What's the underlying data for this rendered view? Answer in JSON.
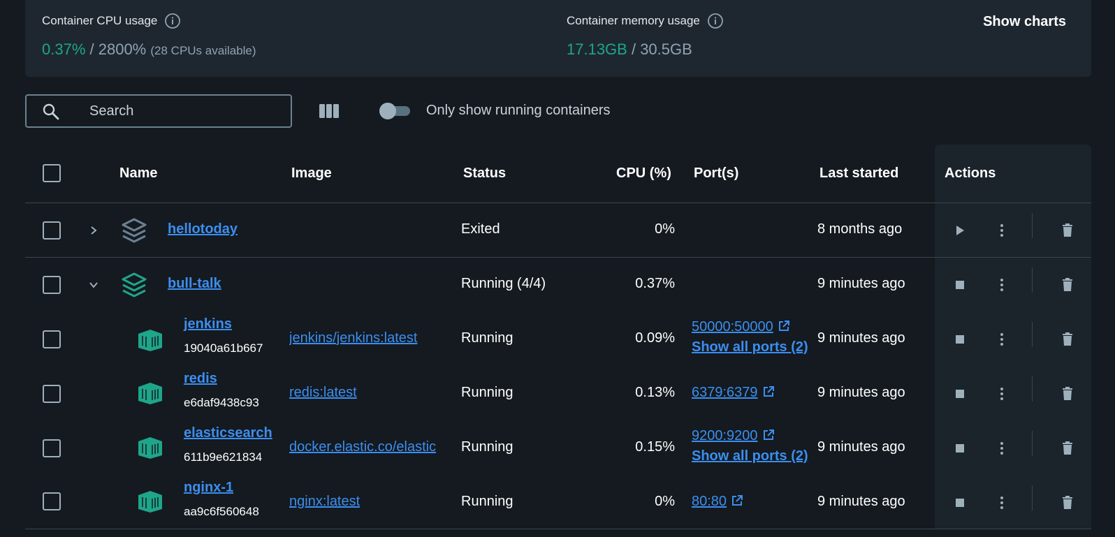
{
  "stats": {
    "cpu_title": "Container CPU usage",
    "cpu_used": "0.37%",
    "cpu_sep": " / ",
    "cpu_total": "2800%",
    "cpu_note": "(28 CPUs available)",
    "mem_title": "Container memory usage",
    "mem_used": "17.13GB",
    "mem_sep": " / ",
    "mem_total": "30.5GB",
    "show_charts": "Show charts"
  },
  "toolbar": {
    "search_placeholder": "Search",
    "toggle_label": "Only show running containers",
    "toggle_on": false
  },
  "table": {
    "headers": {
      "name": "Name",
      "image": "Image",
      "status": "Status",
      "cpu": "CPU (%)",
      "ports": "Port(s)",
      "last_started": "Last started",
      "actions": "Actions"
    },
    "groups": [
      {
        "name": "hellotoday",
        "status": "Exited",
        "cpu": "0%",
        "last_started": "8 months ago",
        "expanded": false
      },
      {
        "name": "bull-talk",
        "status": "Running (4/4)",
        "cpu": "0.37%",
        "last_started": "9 minutes ago",
        "expanded": true
      }
    ],
    "containers": [
      {
        "name": "jenkins",
        "id": "19040a61b667",
        "image": "jenkins/jenkins:latest",
        "status": "Running",
        "cpu": "0.09%",
        "port": "50000:50000",
        "show_ports": "Show all ports (2)",
        "last_started": "9 minutes ago"
      },
      {
        "name": "redis",
        "id": "e6daf9438c93",
        "image": "redis:latest",
        "status": "Running",
        "cpu": "0.13%",
        "port": "6379:6379",
        "show_ports": "",
        "last_started": "9 minutes ago"
      },
      {
        "name": "elasticsearch",
        "id": "611b9e621834",
        "image": "docker.elastic.co/elastic",
        "status": "Running",
        "cpu": "0.15%",
        "port": "9200:9200",
        "show_ports": "Show all ports (2)",
        "last_started": "9 minutes ago"
      },
      {
        "name": "nginx-1",
        "id": "aa9c6f560648",
        "image": "nginx:latest",
        "status": "Running",
        "cpu": "0%",
        "port": "80:80",
        "show_ports": "",
        "last_started": "9 minutes ago"
      }
    ]
  },
  "colors": {
    "accent": "#3c8ef0",
    "green": "#1fa58a",
    "bg": "#141a1f"
  }
}
